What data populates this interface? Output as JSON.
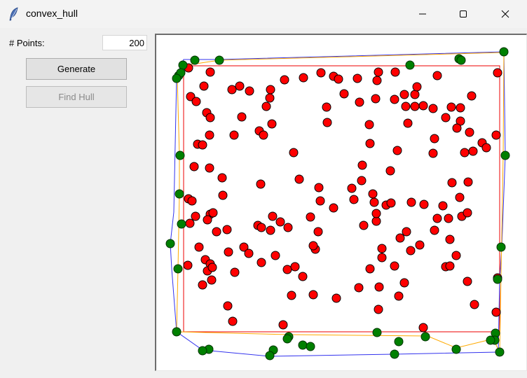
{
  "window": {
    "title": "convex_hull",
    "title_icon": "feather-icon"
  },
  "controls": {
    "points_label": "# Points:",
    "points_value": "200",
    "generate_label": "Generate",
    "find_hull_label": "Find Hull",
    "find_hull_enabled": false
  },
  "colors": {
    "interior_point": "#ff0000",
    "hull_point": "#008000",
    "hull_outline_blue": "#3333ee",
    "hull_outline_orange": "#ffaa00",
    "bounding_box": "#ee0000"
  }
}
